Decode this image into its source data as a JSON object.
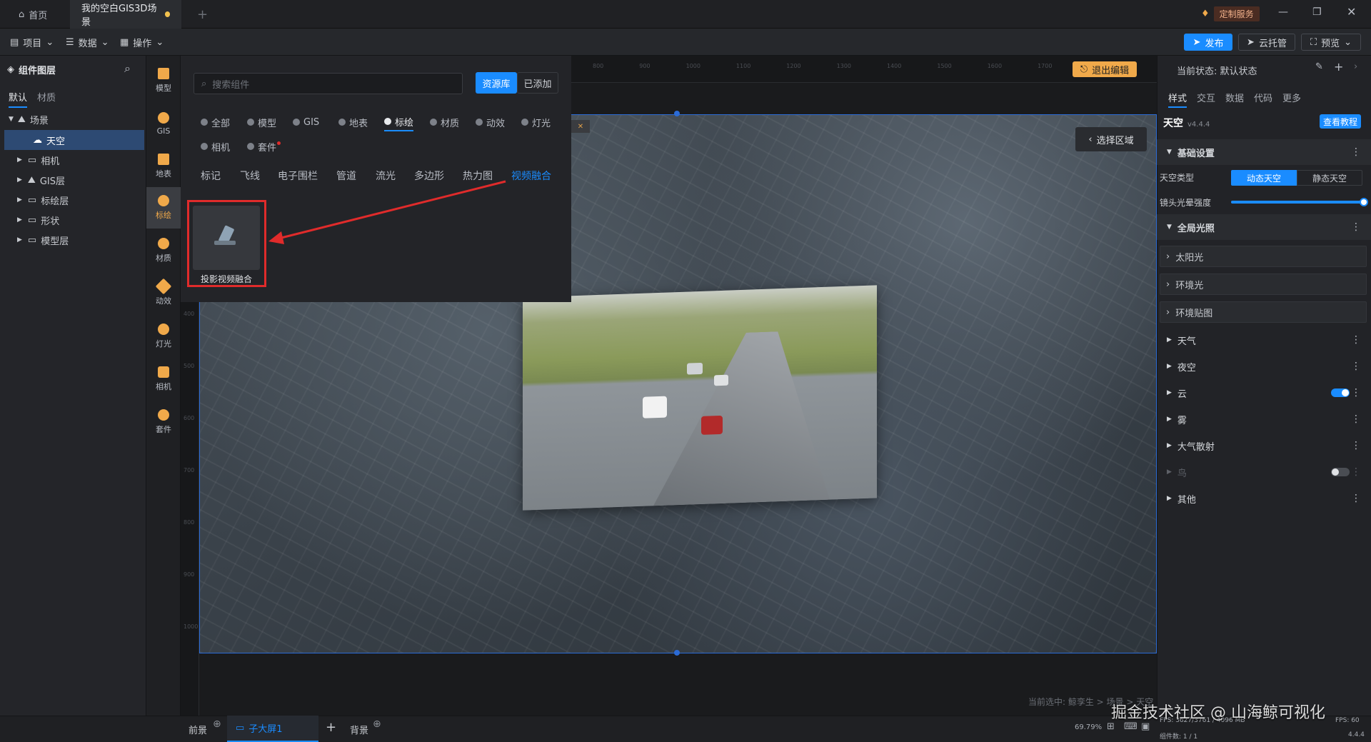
{
  "titlebar": {
    "home_tab": "首页",
    "doc_tab": "我的空白GIS3D场景",
    "add_tab": "+",
    "service_label": "定制服务"
  },
  "menubar": {
    "project": "项目",
    "data": "数据",
    "operate": "操作",
    "publish": "发布",
    "cloud": "云托管",
    "preview": "预览"
  },
  "left": {
    "title": "组件图层",
    "tabs": [
      "默认",
      "材质"
    ],
    "tree": {
      "root": "场景",
      "items": [
        "天空",
        "相机",
        "GIS层",
        "标绘层",
        "形状",
        "模型层"
      ]
    }
  },
  "strip": [
    "模型",
    "GIS",
    "地表",
    "标绘",
    "材质",
    "动效",
    "灯光",
    "相机",
    "套件"
  ],
  "components": {
    "search_placeholder": "搜索组件",
    "btn_library": "资源库",
    "btn_added": "已添加",
    "categories": [
      "全部",
      "模型",
      "GIS",
      "地表",
      "标绘",
      "材质",
      "动效",
      "灯光",
      "相机",
      "套件"
    ],
    "subcategories": [
      "标记",
      "飞线",
      "电子围栏",
      "管道",
      "流光",
      "多边形",
      "热力图",
      "视频融合"
    ],
    "card_label": "投影视频融合"
  },
  "viewport": {
    "exit_edit": "退出编辑",
    "select_region": "选择区域",
    "ruler_top": [
      "800",
      "900",
      "1000",
      "1100",
      "1200",
      "1300",
      "1400",
      "1500",
      "1600",
      "1700"
    ],
    "ruler_left": [
      "400",
      "500",
      "600",
      "700",
      "800",
      "900",
      "1000"
    ],
    "breadcrumb": "当前选中: 鲸孪生 > 场景 > 天空"
  },
  "right": {
    "state_label": "当前状态: 默认状态",
    "tabs": [
      "样式",
      "交互",
      "数据",
      "代码",
      "更多"
    ],
    "component_name": "天空",
    "version": "v4.4.4",
    "tutorial": "查看教程",
    "basic": "基础设置",
    "sky_type_label": "天空类型",
    "sky_type_options": [
      "动态天空",
      "静态天空"
    ],
    "flare_label": "镜头光晕强度",
    "flare_value": 1,
    "global_light": "全局光照",
    "light_items": [
      "太阳光",
      "环境光",
      "环境贴图"
    ],
    "sections": [
      "天气",
      "夜空",
      "云",
      "雾",
      "大气散射",
      "鸟",
      "其他"
    ],
    "cloud_toggle": true,
    "bird_toggle": false
  },
  "bottom": {
    "foreground": "前景",
    "sub_screen": "子大屏1",
    "background": "背景",
    "zoom": "69.79%",
    "stats": "FPS: 3627/3761 / 4096 MB",
    "fps": "FPS: 60",
    "components_count": "组件数: 1 / 1",
    "version": "4.4.4",
    "watermark": "掘金技术社区 @ 山海鲸可视化"
  },
  "colors": {
    "accent": "#1a8cff",
    "orange": "#f0a94a",
    "red_box": "#e02b2b"
  }
}
